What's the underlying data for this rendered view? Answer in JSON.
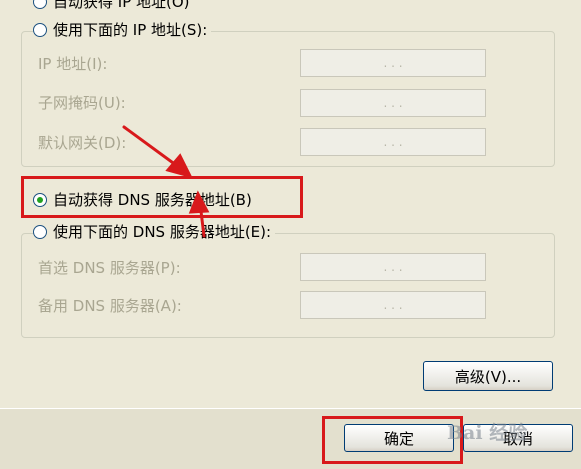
{
  "ip_section": {
    "auto_obtain_label": "自动获得 IP 地址(O)",
    "manual_label": "使用下面的 IP 地址(S):",
    "fields": [
      {
        "label": "IP 地址(I):",
        "value": ". . ."
      },
      {
        "label": "子网掩码(U):",
        "value": ". . ."
      },
      {
        "label": "默认网关(D):",
        "value": ". . ."
      }
    ]
  },
  "dns_section": {
    "auto_obtain_label": "自动获得 DNS 服务器地址(B)",
    "manual_label": "使用下面的 DNS 服务器地址(E):",
    "fields": [
      {
        "label": "首选 DNS 服务器(P):",
        "value": ". . ."
      },
      {
        "label": "备用 DNS 服务器(A):",
        "value": ". . ."
      }
    ]
  },
  "buttons": {
    "advanced": "高级(V)...",
    "ok": "确定",
    "cancel": "取消"
  },
  "watermark": {
    "text": "Bai 经验"
  },
  "colors": {
    "highlight": "#d8191b",
    "radio_dot": "#21a121"
  }
}
